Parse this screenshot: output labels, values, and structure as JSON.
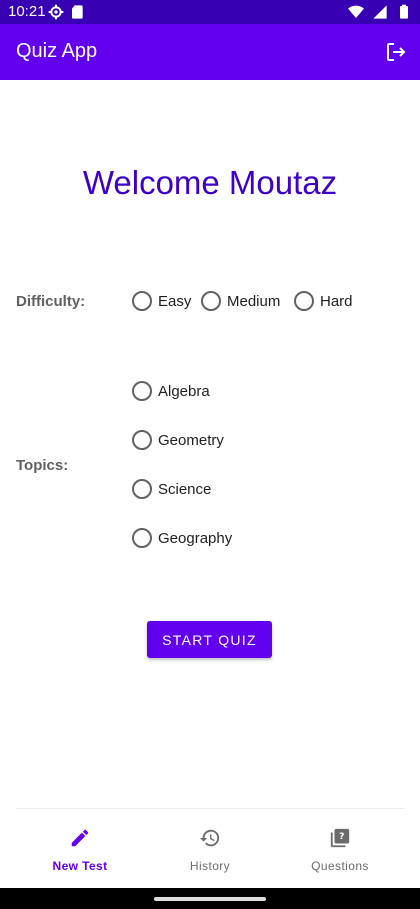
{
  "status_bar": {
    "time": "10:21"
  },
  "app_bar": {
    "title": "Quiz App",
    "logout_icon": "logout-icon"
  },
  "welcome": "Welcome Moutaz",
  "difficulty": {
    "label": "Difficulty:",
    "options": [
      "Easy",
      "Medium",
      "Hard"
    ],
    "selected": null
  },
  "topics": {
    "label": "Topics:",
    "options": [
      "Algebra",
      "Geometry",
      "Science",
      "Geography"
    ],
    "selected": null
  },
  "start_button": "START QUIZ",
  "bottom_nav": {
    "items": [
      {
        "label": "New Test",
        "icon": "pencil-icon",
        "active": true
      },
      {
        "label": "History",
        "icon": "history-icon",
        "active": false
      },
      {
        "label": "Questions",
        "icon": "questions-icon",
        "active": false
      }
    ]
  },
  "colors": {
    "primary": "#6200ee",
    "status_bar": "#3700b3",
    "welcome_text": "#3c00c8"
  }
}
